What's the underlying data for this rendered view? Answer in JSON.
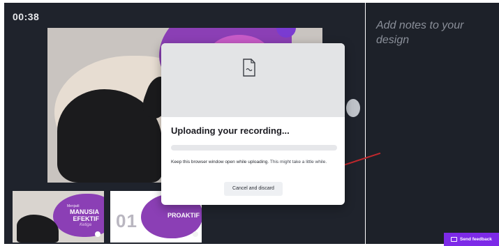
{
  "timer": "00:38",
  "notes": {
    "placeholder": "Add notes to your design"
  },
  "thumbnails": [
    {
      "small_text": "Menjadi",
      "title": "MANUSIA EFEKTIF",
      "sub": "Ketiga"
    },
    {
      "number": "01",
      "title": "PROAKTIF"
    }
  ],
  "dialog": {
    "icon": "file-icon",
    "title": "Uploading your recording...",
    "progress": 0.0,
    "message_strong": "Keep this browser window open while uploading.",
    "message_rest": " This might take a little while.",
    "cancel_label": "Cancel and discard"
  },
  "feedback": {
    "label": "Send feedback",
    "icon": "feedback-icon"
  },
  "colors": {
    "accent": "#7d2ae8",
    "stage": "#1f232c",
    "annotation": "#c0282d"
  }
}
